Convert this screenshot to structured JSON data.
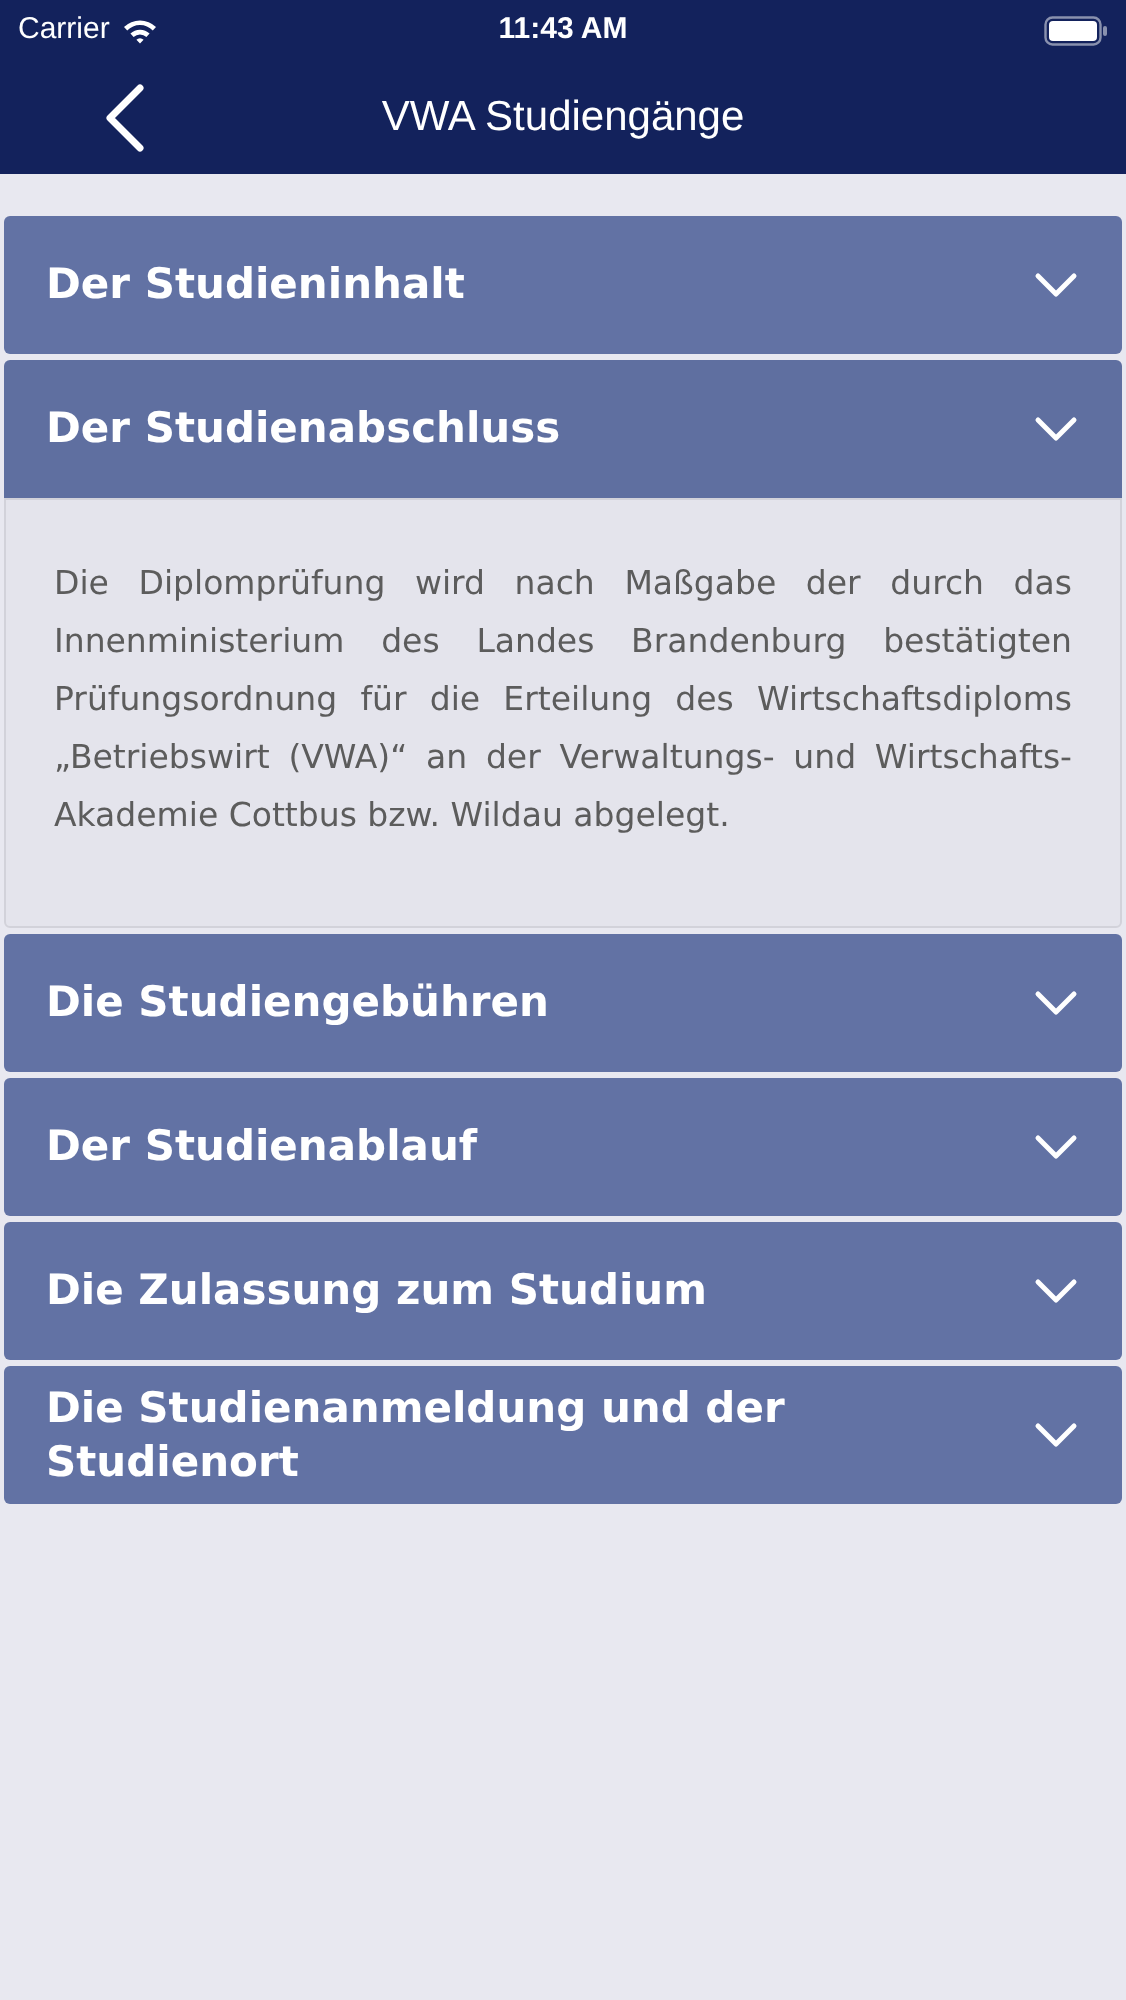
{
  "status_bar": {
    "carrier": "Carrier",
    "time": "11:43 AM"
  },
  "nav": {
    "title": "VWA Studiengänge"
  },
  "sections": [
    {
      "title": "Der Studieninhalt",
      "expanded": false
    },
    {
      "title": "Der Studienabschluss",
      "expanded": true,
      "body": "Die Diplomprüfung wird nach Maßgabe der durch das Innenministerium des Landes Brandenburg bestätigten Prüfungsordnung für die Erteilung des Wirtschaftsdiploms „Betriebswirt (VWA)“ an der Verwaltungs- und Wirtschafts-Akademie Cottbus bzw. Wildau abgelegt."
    },
    {
      "title": "Die Studiengebühren",
      "expanded": false
    },
    {
      "title": "Der Studienablauf",
      "expanded": false
    },
    {
      "title": "Die Zulassung zum Studium",
      "expanded": false
    },
    {
      "title": "Die Studienanmeldung und der Studienort",
      "expanded": false
    }
  ]
}
